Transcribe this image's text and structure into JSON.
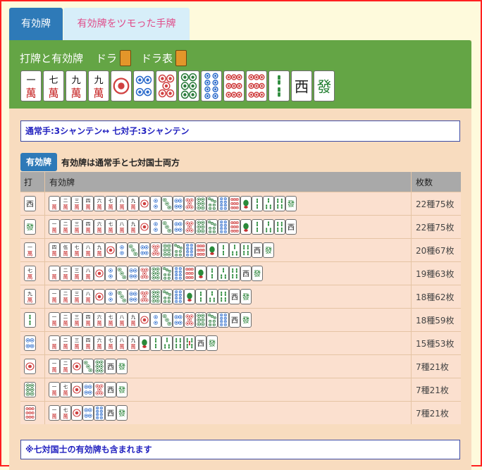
{
  "tabs": [
    {
      "label": "有効牌",
      "active": true
    },
    {
      "label": "有効牌をツモった手牌",
      "active": false
    }
  ],
  "header": {
    "discard_label": "打牌と有効牌",
    "dora_label": "ドラ",
    "dora_indicator_label": "ドラ表"
  },
  "hand": [
    "1m",
    "7m",
    "9m",
    "9m",
    "1p",
    "4p",
    "5p",
    "6p",
    "8p",
    "9p",
    "9p",
    "2s",
    "we",
    "hatsu"
  ],
  "shanten": {
    "text": "通常手:3シャンテン↔ 七対子:3シャンテン"
  },
  "yuko": {
    "badge": "有効牌",
    "note": "有効牌は通常手と七対国士両方"
  },
  "table": {
    "headers": [
      "打",
      "有効牌",
      "枚数"
    ],
    "rows": [
      {
        "discard": "we",
        "tiles": [
          "1m",
          "2m",
          "3m",
          "4m",
          "6m",
          "7m",
          "8m",
          "9m",
          "1p",
          "2p",
          "3p",
          "4p",
          "5p",
          "6p",
          "7p",
          "8p",
          "9p",
          "1s",
          "2s",
          "3s",
          "4s",
          "hatsu"
        ],
        "count": "22種75枚"
      },
      {
        "discard": "hatsu",
        "tiles": [
          "1m",
          "2m",
          "3m",
          "4m",
          "6m",
          "7m",
          "8m",
          "9m",
          "1p",
          "2p",
          "3p",
          "4p",
          "5p",
          "6p",
          "7p",
          "8p",
          "9p",
          "1s",
          "2s",
          "3s",
          "4s",
          "we"
        ],
        "count": "22種75枚"
      },
      {
        "discard": "1m",
        "tiles": [
          "4m",
          "5m",
          "7m",
          "8m",
          "9m",
          "1p",
          "2p",
          "3p",
          "4p",
          "5p",
          "6p",
          "7p",
          "8p",
          "9p",
          "1s",
          "2s",
          "3s",
          "4s",
          "we",
          "hatsu"
        ],
        "count": "20種67枚"
      },
      {
        "discard": "7m",
        "tiles": [
          "1m",
          "2m",
          "3m",
          "8m",
          "1p",
          "2p",
          "3p",
          "4p",
          "5p",
          "6p",
          "7p",
          "8p",
          "9p",
          "1s",
          "2s",
          "3s",
          "4s",
          "we",
          "hatsu"
        ],
        "count": "19種63枚"
      },
      {
        "discard": "9m",
        "tiles": [
          "1m",
          "2m",
          "3m",
          "8m",
          "1p",
          "2p",
          "3p",
          "4p",
          "5p",
          "6p",
          "7p",
          "8p",
          "1s",
          "2s",
          "3s",
          "4s",
          "we",
          "hatsu"
        ],
        "count": "18種62枚"
      },
      {
        "discard": "2s",
        "tiles": [
          "1m",
          "2m",
          "3m",
          "4m",
          "6m",
          "7m",
          "8m",
          "9m",
          "1p",
          "2p",
          "3p",
          "4p",
          "5p",
          "6p",
          "7p",
          "8p",
          "we",
          "hatsu"
        ],
        "count": "18種59枚"
      },
      {
        "discard": "4p",
        "tiles": [
          "1m",
          "2m",
          "3m",
          "4m",
          "6m",
          "7m",
          "8m",
          "9m",
          "1s",
          "2s",
          "3s",
          "4s",
          "5s",
          "we",
          "hatsu"
        ],
        "count": "15種53枚"
      },
      {
        "discard": "1p",
        "tiles": [
          "1m",
          "2m",
          "1p",
          "3p",
          "6p",
          "we",
          "hatsu"
        ],
        "count": "7種21枚"
      },
      {
        "discard": "6p",
        "tiles": [
          "1m",
          "7m",
          "1p",
          "4p",
          "5p",
          "we",
          "hatsu"
        ],
        "count": "7種21枚"
      },
      {
        "discard": "9p",
        "tiles": [
          "1m",
          "7m",
          "1p",
          "4p",
          "8p",
          "we",
          "hatsu"
        ],
        "count": "7種21枚"
      }
    ]
  },
  "footnote": "※七対国士の有効牌も含まれます",
  "colors": {
    "tab_active": "#2e7ab8",
    "tab_inactive_bg": "#d7eef9",
    "tab_inactive_text": "#e04d8a",
    "header_green": "#64a545",
    "panel_bg": "#f8dcbf",
    "text_blue": "#2323c0"
  }
}
